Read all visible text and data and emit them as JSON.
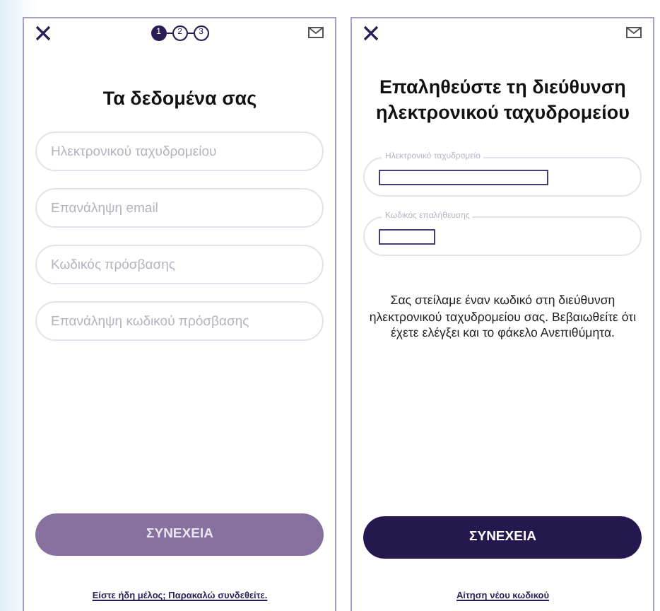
{
  "screens": [
    {
      "steps": [
        {
          "label": "1",
          "selected": true
        },
        {
          "label": "2",
          "selected": false
        },
        {
          "label": "3",
          "selected": false
        }
      ],
      "title": "Τα δεδομένα σας",
      "fields": [
        {
          "placeholder": "Ηλεκτρονικού ταχυδρομείου"
        },
        {
          "placeholder": "Επανάληψη email"
        },
        {
          "placeholder": "Κωδικός πρόσβασης"
        },
        {
          "placeholder": "Επανάληψη κωδικού πρόσβασης"
        }
      ],
      "button": {
        "label": "ΣΥΝΕΧΕΙΑ",
        "disabled": true
      },
      "footer_link": "Είστε ήδη μέλος; Παρακαλώ συνδεθείτε."
    },
    {
      "title": "Επαληθεύστε τη διεύθυνση ηλεκτρονικού ταχυδρομείου",
      "fields": [
        {
          "label": "Ηλεκτρονικό ταχυδρομείο",
          "redacted": true
        },
        {
          "label": "Κωδικός επαλήθευσης",
          "redacted": true
        }
      ],
      "message": "Σας στείλαμε έναν κωδικό στη διεύθυνση ηλεκτρονικού ταχυδρομείου σας. Βεβαιωθείτε ότι έχετε ελέγξει και το φάκελο Ανεπιθύμητα.",
      "button": {
        "label": "ΣΥΝΕΧΕΙΑ",
        "disabled": false
      },
      "footer_link": "Αίτηση νέου κωδικού"
    }
  ]
}
